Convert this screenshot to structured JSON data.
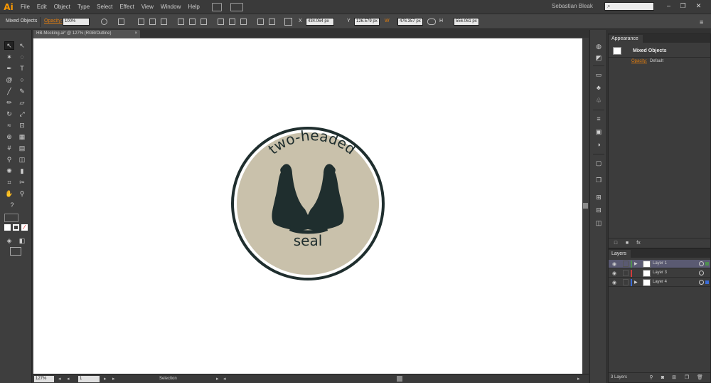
{
  "app": {
    "logo": "Ai",
    "menus": [
      "File",
      "Edit",
      "Object",
      "Type",
      "Select",
      "Effect",
      "View",
      "Window",
      "Help"
    ],
    "user": "Sebastian Bleak",
    "search_placeholder": "",
    "window_buttons": [
      "–",
      "❐",
      "✕"
    ]
  },
  "control_bar": {
    "selection_label": "Mixed Objects",
    "opacity_label": "Opacity:",
    "opacity_value": "100%",
    "x_value": "434.064 px",
    "y_value": "126.579 px",
    "w_value": "476.357 px",
    "h_value": "556.061 px"
  },
  "document": {
    "tab_title": "HB-Mocking.ai* @ 127% (RGB/Outline)",
    "tab_close": "×"
  },
  "artwork": {
    "top_text": "two-headed",
    "bottom_text": "seal",
    "badge_color": "#c9c1ab",
    "ink_color": "#1f2e2e"
  },
  "status_bar": {
    "zoom": "127%",
    "artboard": "1",
    "tool_status": "Selection"
  },
  "appearance": {
    "tab_label": "Appearance",
    "object_title": "Mixed Objects",
    "opacity_link": "Opacity:",
    "opacity_value": "Default"
  },
  "layers": {
    "tab_label": "Layers",
    "rows": [
      {
        "name": "Layer 1",
        "color": "#4f8f4f",
        "selected": true
      },
      {
        "name": "Layer 3",
        "color": "#d13b3b",
        "selected": false
      },
      {
        "name": "Layer 4",
        "color": "#3a6bd6",
        "selected": false
      }
    ],
    "count": "3 Layers"
  },
  "colors": {
    "accent": "#ff9a00",
    "link": "#e07d10",
    "selected_layer": "#5a5a72"
  }
}
